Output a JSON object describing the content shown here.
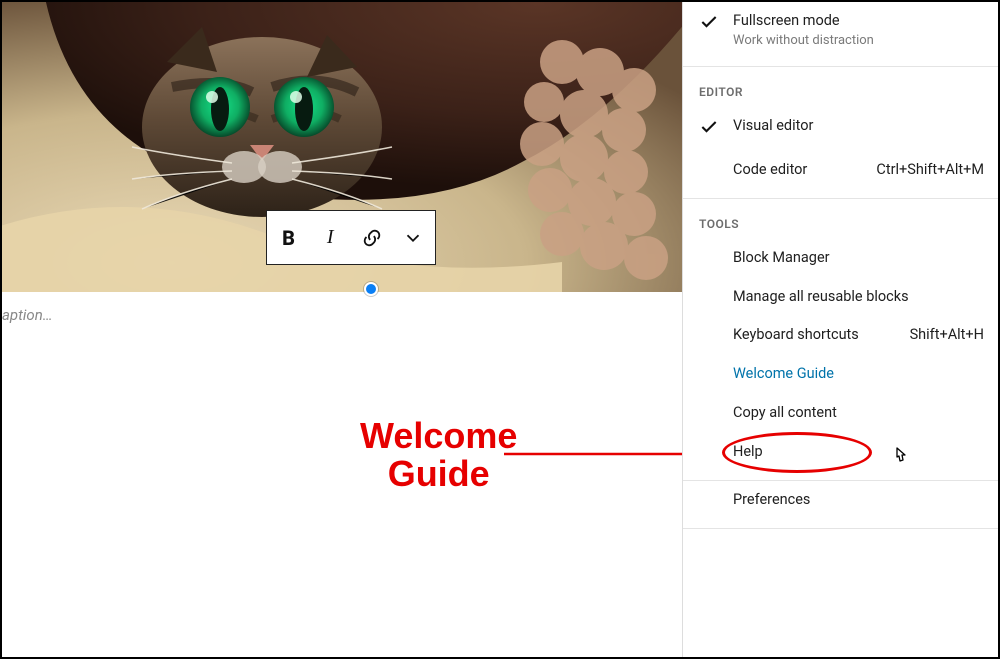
{
  "caption_placeholder": "aption…",
  "toolbar": {
    "bold": "B",
    "italic": "I"
  },
  "annotation": {
    "label_line1": "Welcome",
    "label_line2": "Guide"
  },
  "groups": [
    {
      "header": "",
      "items": [
        {
          "checked": true,
          "label": "Fullscreen mode",
          "sub": "Work without distraction",
          "shortcut": "",
          "hl": false
        }
      ]
    },
    {
      "header": "Editor",
      "items": [
        {
          "checked": true,
          "label": "Visual editor",
          "sub": "",
          "shortcut": "",
          "hl": false
        },
        {
          "checked": false,
          "label": "Code editor",
          "sub": "",
          "shortcut": "Ctrl+Shift+Alt+M",
          "hl": false
        }
      ]
    },
    {
      "header": "Tools",
      "items": [
        {
          "checked": false,
          "label": "Block Manager",
          "sub": "",
          "shortcut": "",
          "hl": false
        },
        {
          "checked": false,
          "label": "Manage all reusable blocks",
          "sub": "",
          "shortcut": "",
          "hl": false
        },
        {
          "checked": false,
          "label": "Keyboard shortcuts",
          "sub": "",
          "shortcut": "Shift+Alt+H",
          "hl": false
        },
        {
          "checked": false,
          "label": "Welcome Guide",
          "sub": "",
          "shortcut": "",
          "hl": true
        },
        {
          "checked": false,
          "label": "Copy all content",
          "sub": "",
          "shortcut": "",
          "hl": false
        },
        {
          "checked": false,
          "label": "Help",
          "sub": "",
          "shortcut": "",
          "hl": false
        }
      ]
    },
    {
      "header": "",
      "items": [
        {
          "checked": false,
          "label": "Preferences",
          "sub": "",
          "shortcut": "",
          "hl": false
        }
      ]
    }
  ]
}
